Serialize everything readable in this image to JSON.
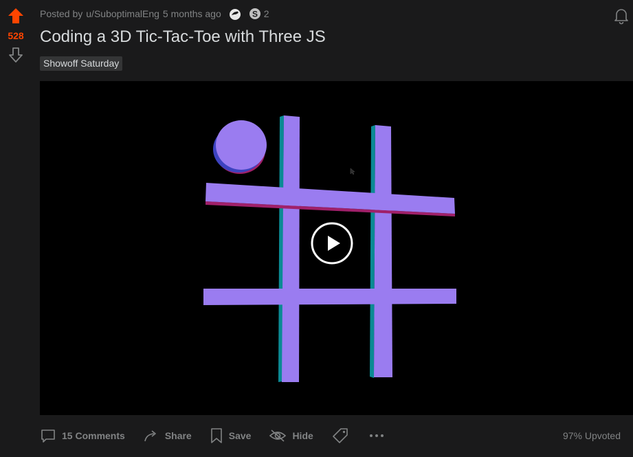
{
  "post": {
    "score": "528",
    "posted_by_prefix": "Posted by",
    "author": "u/SuboptimalEng",
    "age": "5 months ago",
    "award_count": "2",
    "title": "Coding a 3D Tic-Tac-Toe with Three JS",
    "flair": "Showoff Saturday"
  },
  "footer": {
    "comments": "15 Comments",
    "share": "Share",
    "save": "Save",
    "hide": "Hide",
    "upvoted": "97% Upvoted"
  },
  "colors": {
    "upvote": "#ff4500",
    "background": "#1a1a1b",
    "board_face": "#9a7cf0",
    "board_side_teal": "#0b8a94",
    "board_side_magenta": "#a0206a"
  },
  "icons": [
    "upvote-arrow-icon",
    "downvote-arrow-icon",
    "award-icon",
    "silver-award-icon",
    "bell-icon",
    "play-icon",
    "comment-icon",
    "share-icon",
    "bookmark-icon",
    "hide-eye-icon",
    "tag-icon",
    "more-icon"
  ]
}
